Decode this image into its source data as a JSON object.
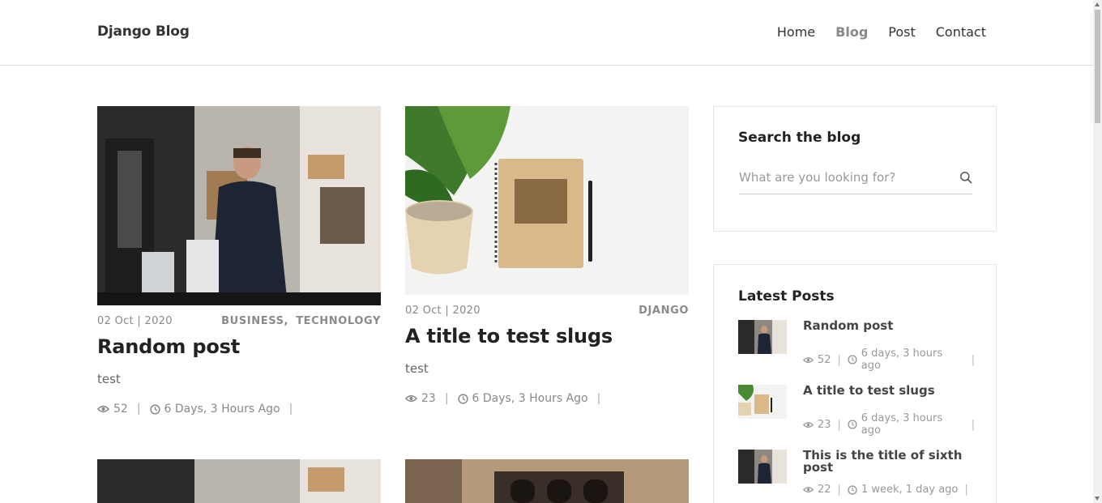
{
  "header": {
    "brand": "Django Blog",
    "nav": [
      "Home",
      "Blog",
      "Post",
      "Contact"
    ],
    "active": "Blog"
  },
  "posts": [
    {
      "date": "02 Oct | 2020",
      "categories": [
        "BUSINESS,",
        "TECHNOLOGY"
      ],
      "title": "Random post",
      "excerpt": "test",
      "views": "52",
      "ago": "6 Days, 3 Hours Ago",
      "trail": "|",
      "image": "barista-photo"
    },
    {
      "date": "02 Oct | 2020",
      "categories": [
        "DJANGO"
      ],
      "title": "A title to test slugs",
      "excerpt": "test",
      "views": "23",
      "ago": "6 Days, 3 Hours Ago",
      "trail": "|",
      "image": "notebook-plant-photo"
    }
  ],
  "sidebar": {
    "search": {
      "title": "Search the blog",
      "placeholder": "What are you looking for?"
    },
    "latest": {
      "title": "Latest Posts",
      "items": [
        {
          "title": "Random post",
          "views": "52",
          "ago": "6 days, 3 hours ago",
          "trail": "|"
        },
        {
          "title": "A title to test slugs",
          "views": "23",
          "ago": "6 days, 3 hours ago",
          "trail": "|"
        },
        {
          "title": "This is the title of sixth post",
          "views": "22",
          "ago": "1 week, 1 day ago",
          "trail": "|"
        }
      ]
    }
  },
  "separators": {
    "stat": "|"
  },
  "colors": {
    "text": "#222222",
    "muted": "#888888",
    "active_nav": "#888888",
    "border": "#e5e5e5"
  },
  "icons": [
    "eye-icon",
    "clock-icon",
    "search-icon"
  ]
}
